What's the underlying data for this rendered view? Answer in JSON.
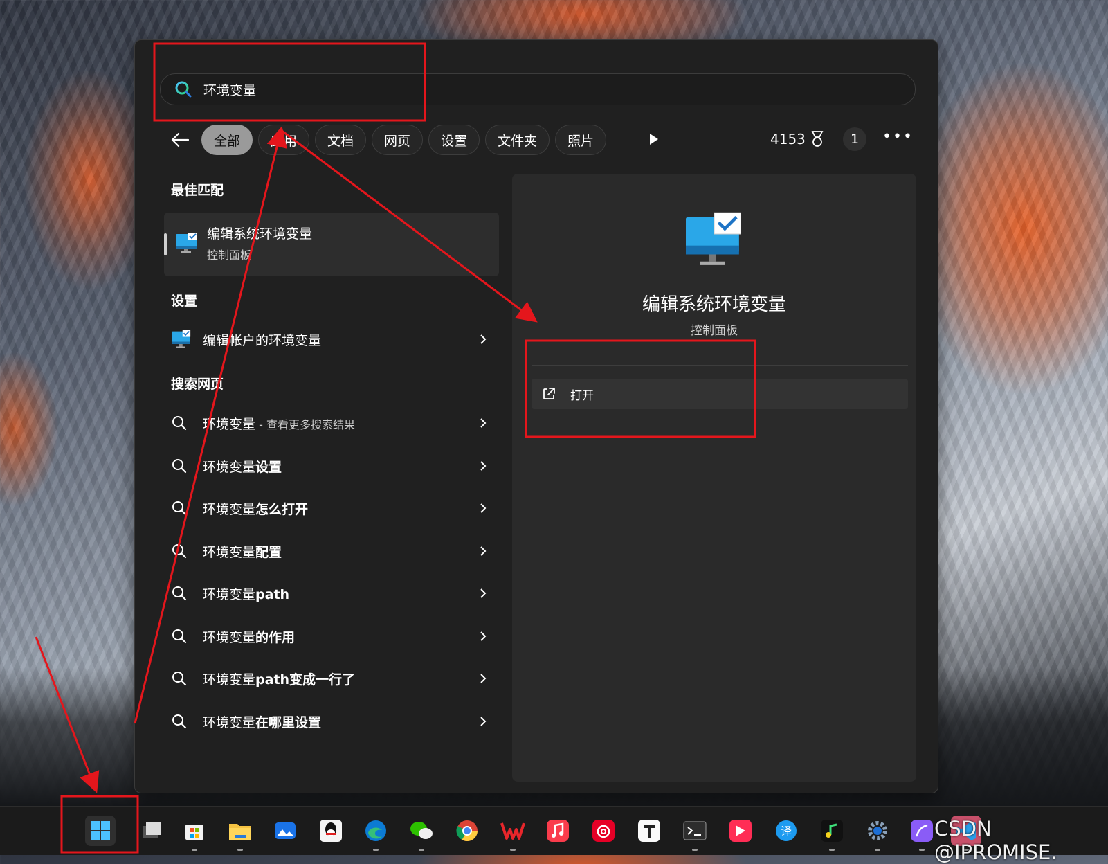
{
  "search": {
    "query": "环境变量"
  },
  "filters": {
    "back_label": "",
    "chips": [
      "全部",
      "应用",
      "文档",
      "网页",
      "设置",
      "文件夹",
      "照片"
    ],
    "active": "全部",
    "points": "4153",
    "count": "1",
    "more": "•••"
  },
  "sections": {
    "best_match": "最佳匹配",
    "settings": "设置",
    "web": "搜索网页"
  },
  "best_match": {
    "title": "编辑系统环境变量",
    "subtitle": "控制面板"
  },
  "settings_items": [
    {
      "label": "编辑帐户的环境变量"
    }
  ],
  "web_items": [
    {
      "prefix": "环境变量",
      "suffix": " - 查看更多搜索结果",
      "bold": ""
    },
    {
      "prefix": "环境变量",
      "bold": "设置"
    },
    {
      "prefix": "环境变量",
      "bold": "怎么打开"
    },
    {
      "prefix": "环境变量",
      "bold": "配置"
    },
    {
      "prefix": "环境变量",
      "bold": "path"
    },
    {
      "prefix": "环境变量",
      "bold": "的作用"
    },
    {
      "prefix": "环境变量",
      "bold": "path变成一行了"
    },
    {
      "prefix": "环境变量",
      "bold": "在哪里设置"
    }
  ],
  "preview": {
    "title": "编辑系统环境变量",
    "subtitle": "控制面板",
    "action_open": "打开"
  },
  "taskbar": {
    "icons": [
      "start-icon",
      "task-view-icon",
      "microsoft-store-icon",
      "file-explorer-icon",
      "photos-icon",
      "qq-icon",
      "edge-icon",
      "wechat-icon",
      "chrome-icon",
      "wps-icon",
      "apple-music-icon",
      "netease-music-icon",
      "typora-icon",
      "terminal-icon",
      "kuaishou-icon",
      "translate-icon",
      "music-icon",
      "settings-icon",
      "app-icon",
      "vscode-icon"
    ]
  },
  "watermark": "CSDN @IPROMISE.",
  "colors": {
    "annotation": "#e4161c",
    "panel": "#202020",
    "accent": "#4cc2ff"
  }
}
